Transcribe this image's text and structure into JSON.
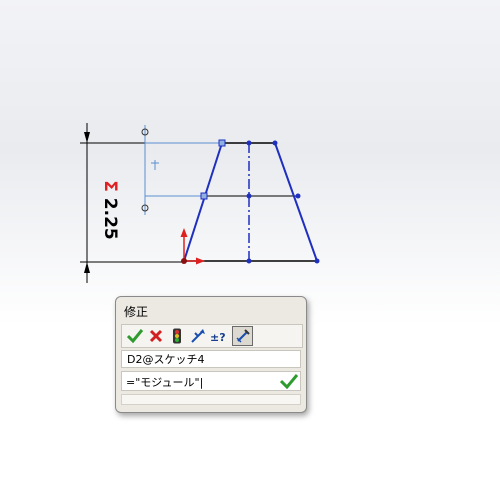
{
  "sketch": {
    "dimension_label": "2.25",
    "dimension_marker": "Σ"
  },
  "dialog": {
    "title": "修正",
    "parameter_name": "D2@スケッチ4",
    "expression_value": "=\"モジュール\"|"
  },
  "toolbar": {
    "icons": [
      "ok-check-icon",
      "cancel-x-icon",
      "rebuild-traffic-light-icon",
      "reverse-dimension-icon",
      "plus-minus-question-icon",
      "mark-for-drawing-icon"
    ]
  },
  "colors": {
    "sketch_blue": "#1f2fbf",
    "construction_blue": "#5a8fd0",
    "ok_green": "#2e9b2e",
    "cancel_red": "#d02020"
  }
}
